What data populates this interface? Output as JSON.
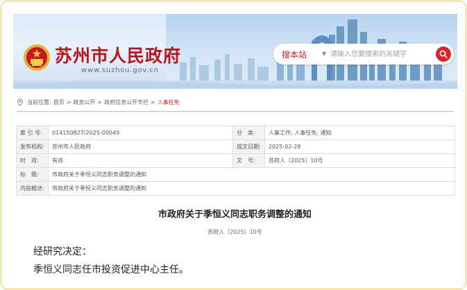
{
  "header": {
    "site_title": "苏州市人民政府",
    "site_url": "www.suzhou.gov.cn",
    "search": {
      "scope_label": "搜本站",
      "placeholder": "请输入您要搜索的关键字"
    }
  },
  "breadcrumb": {
    "prefix": "当前位置:",
    "items": [
      "首页",
      "政务公开",
      "政府信息公开专栏",
      "人事任免"
    ],
    "separator": ">"
  },
  "info_table": {
    "rows": [
      {
        "k1": "索 引 号:",
        "v1": "014150827/2025-00049",
        "k2": "分　类:",
        "v2": "人事工作;  人事任免;  通知"
      },
      {
        "k1": "发布机构:",
        "v1": "苏州市人民政府",
        "k2": "成文日期:",
        "v2": "2025-02-28"
      },
      {
        "k1": "时　效:",
        "v1": "有效",
        "k2": "文　号:",
        "v2": "苏府人〔2025〕10号"
      }
    ],
    "title_label": "标　题:",
    "title_value": "市政府关于季恒义同志职务调整的通知",
    "summary_label": "内容概述:",
    "summary_value": "市政府关于季恒义同志职务调整的通知"
  },
  "article": {
    "title": "市政府关于季恒义同志职务调整的通知",
    "doc_number": "苏府人〔2025〕10号",
    "paragraphs": [
      "经研究决定：",
      "季恒义同志任市投资促进中心主任。"
    ]
  },
  "colors": {
    "brand_red": "#b5161d",
    "accent_blue": "#9ec3e6",
    "frame_gold": "#f2c94c"
  }
}
